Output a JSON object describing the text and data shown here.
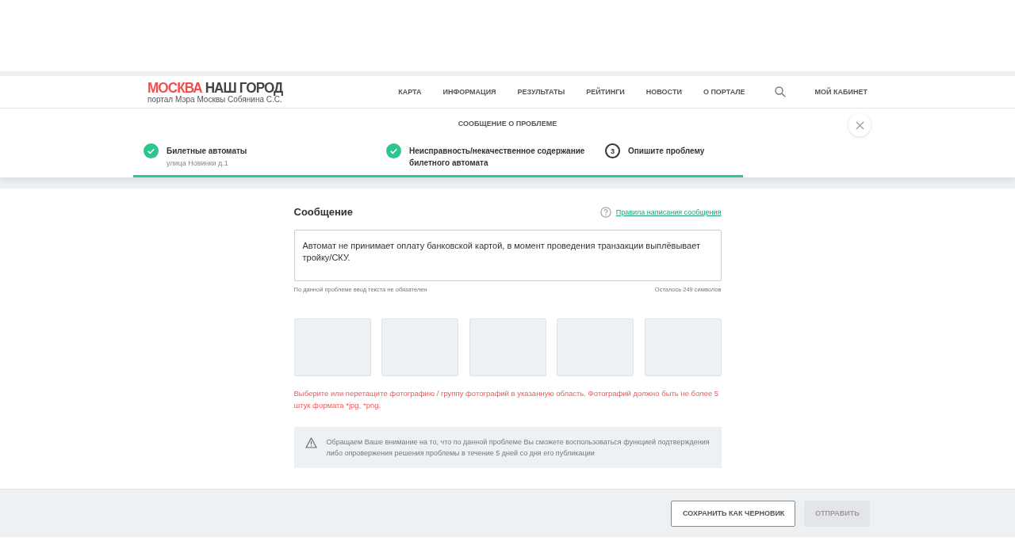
{
  "header": {
    "logo": {
      "accent": "МОСКВА",
      "main": "НАШ ГОРОД",
      "subtitle": "портал Мэра Москвы Собянина С.С."
    },
    "nav": [
      "КАРТА",
      "ИНФОРМАЦИЯ",
      "РЕЗУЛЬТАТЫ",
      "РЕЙТИНГИ",
      "НОВОСТИ",
      "О ПОРТАЛЕ"
    ],
    "account": "МОЙ КАБИНЕТ"
  },
  "dialog": {
    "title": "СООБЩЕНИЕ О ПРОБЛЕМЕ",
    "steps": [
      {
        "title": "Билетные автоматы",
        "subtitle": "улица Новинки д.1",
        "kind": "done"
      },
      {
        "title": "Неисправность/некачественное содержание билетного автомата",
        "kind": "done"
      },
      {
        "title": "Опишите проблему",
        "number": "3",
        "kind": "current"
      }
    ]
  },
  "form": {
    "heading": "Сообщение",
    "rules_link": "Правила написания сообщения",
    "message": "Автомат не принимает оплату банковской картой, в момент проведения транзакции выплёвывает тройку/СКУ.",
    "hint": "По данной проблеме ввод текста не обязателен",
    "counter": "Осталось 249 символов",
    "photo_slots": [
      {
        "filled": false
      },
      {
        "filled": false
      },
      {
        "filled": false
      },
      {
        "filled": false
      },
      {
        "filled": false
      }
    ],
    "photo_error": "Выберите или перетащите фотографию / группу фотографий в указанную область. Фотографий должно быть не более 5 штук формата *jpg, *png.",
    "notice": "Обращаем Ваше внимание на то, что по данной проблеме Вы сможете воспользоваться функцией подтверждения либо опровержения решения проблемы в течение 5 дней со дня его публикации"
  },
  "footer": {
    "buttons": [
      {
        "label": "СОХРАНИТЬ КАК ЧЕРНОВИК",
        "disabled": false
      },
      {
        "label": "ОТПРАВИТЬ",
        "disabled": true
      }
    ]
  }
}
